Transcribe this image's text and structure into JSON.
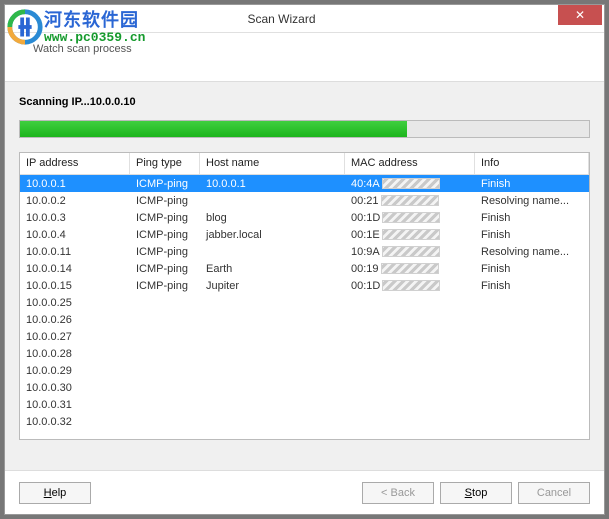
{
  "window": {
    "title": "Scan Wizard",
    "subtitle": "Watch scan process"
  },
  "watermark": {
    "name": "河东软件园",
    "url": "www.pc0359.cn"
  },
  "scan": {
    "status_label": "Scanning IP...10.0.0.10",
    "progress_percent": 68
  },
  "table": {
    "columns": {
      "ip": "IP address",
      "ping": "Ping type",
      "host": "Host name",
      "mac": "MAC address",
      "info": "Info"
    },
    "rows": [
      {
        "ip": "10.0.0.1",
        "ping": "ICMP-ping",
        "host": "10.0.0.1",
        "mac": "40:4A",
        "info": "Finish",
        "selected": true
      },
      {
        "ip": "10.0.0.2",
        "ping": "ICMP-ping",
        "host": "",
        "mac": "00:21",
        "info": "Resolving name...",
        "selected": false
      },
      {
        "ip": "10.0.0.3",
        "ping": "ICMP-ping",
        "host": "blog",
        "mac": "00:1D",
        "info": "Finish",
        "selected": false
      },
      {
        "ip": "10.0.0.4",
        "ping": "ICMP-ping",
        "host": "jabber.local",
        "mac": "00:1E",
        "info": "Finish",
        "selected": false
      },
      {
        "ip": "10.0.0.11",
        "ping": "ICMP-ping",
        "host": "",
        "mac": "10:9A",
        "info": "Resolving name...",
        "selected": false
      },
      {
        "ip": "10.0.0.14",
        "ping": "ICMP-ping",
        "host": "Earth",
        "mac": "00:19",
        "info": "Finish",
        "selected": false
      },
      {
        "ip": "10.0.0.15",
        "ping": "ICMP-ping",
        "host": "Jupiter",
        "mac": "00:1D",
        "info": "Finish",
        "selected": false
      },
      {
        "ip": "10.0.0.25",
        "ping": "",
        "host": "",
        "mac": "",
        "info": "",
        "selected": false
      },
      {
        "ip": "10.0.0.26",
        "ping": "",
        "host": "",
        "mac": "",
        "info": "",
        "selected": false
      },
      {
        "ip": "10.0.0.27",
        "ping": "",
        "host": "",
        "mac": "",
        "info": "",
        "selected": false
      },
      {
        "ip": "10.0.0.28",
        "ping": "",
        "host": "",
        "mac": "",
        "info": "",
        "selected": false
      },
      {
        "ip": "10.0.0.29",
        "ping": "",
        "host": "",
        "mac": "",
        "info": "",
        "selected": false
      },
      {
        "ip": "10.0.0.30",
        "ping": "",
        "host": "",
        "mac": "",
        "info": "",
        "selected": false
      },
      {
        "ip": "10.0.0.31",
        "ping": "",
        "host": "",
        "mac": "",
        "info": "",
        "selected": false
      },
      {
        "ip": "10.0.0.32",
        "ping": "",
        "host": "",
        "mac": "",
        "info": "",
        "selected": false
      }
    ]
  },
  "buttons": {
    "help": "Help",
    "back": "< Back",
    "stop": "Stop",
    "cancel": "Cancel"
  }
}
